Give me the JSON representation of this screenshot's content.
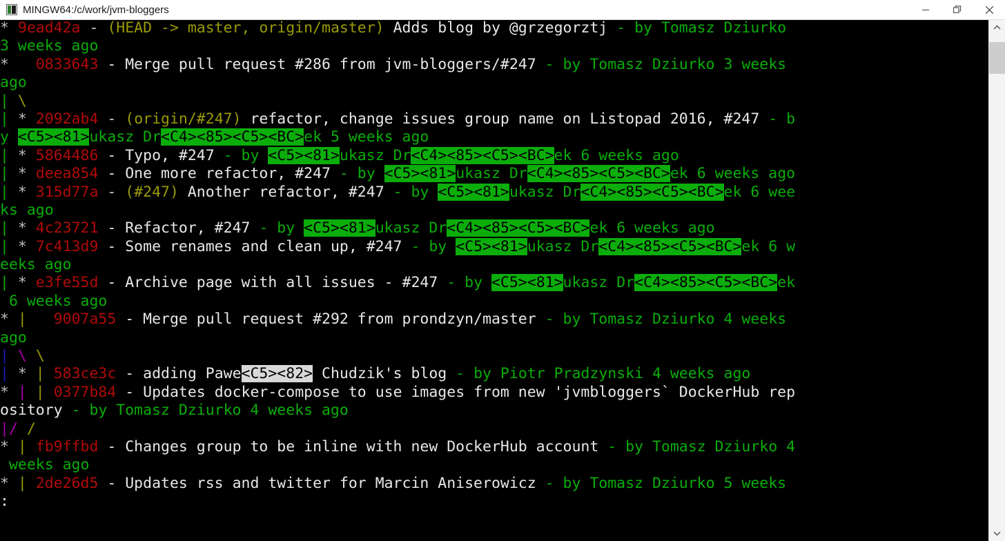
{
  "window": {
    "title": "MINGW64:/c/work/jvm-bloggers",
    "minimize_label": "Minimize",
    "maximize_label": "Restore",
    "close_label": "Close"
  },
  "scrollbar": {
    "up_label": "Scroll up",
    "down_label": "Scroll down"
  },
  "terminal": {
    "prompt": ":",
    "rows": [
      [
        {
          "t": "* ",
          "c": "c-gray"
        },
        {
          "t": "9ead42a",
          "c": "c-red"
        },
        {
          "t": " - ",
          "c": "c-default"
        },
        {
          "t": "(HEAD -> master, origin/master)",
          "c": "c-yellow"
        },
        {
          "t": " Adds blog by @grzegorztj",
          "c": "c-white"
        },
        {
          "t": " - by Tomasz Dziurko",
          "c": "c-green"
        }
      ],
      [
        {
          "t": "3 weeks ago",
          "c": "c-green"
        }
      ],
      [
        {
          "t": "*   ",
          "c": "c-gray"
        },
        {
          "t": "0833643",
          "c": "c-red"
        },
        {
          "t": " - Merge pull request #286 from jvm-bloggers/#247",
          "c": "c-white"
        },
        {
          "t": " - by Tomasz Dziurko 3 weeks",
          "c": "c-green"
        }
      ],
      [
        {
          "t": "ago",
          "c": "c-green"
        }
      ],
      [
        {
          "t": "|",
          "c": "c-green"
        },
        {
          "t": " ",
          "c": "c-default"
        },
        {
          "t": "\\",
          "c": "c-yellow"
        }
      ],
      [
        {
          "t": "|",
          "c": "c-green"
        },
        {
          "t": " * ",
          "c": "c-gray"
        },
        {
          "t": "2092ab4",
          "c": "c-red"
        },
        {
          "t": " - ",
          "c": "c-default"
        },
        {
          "t": "(origin/#247)",
          "c": "c-yellow"
        },
        {
          "t": " refactor, change issues group name on Listopad 2016, #247",
          "c": "c-white"
        },
        {
          "t": " - b",
          "c": "c-green"
        }
      ],
      [
        {
          "t": "y",
          "c": "c-green"
        },
        {
          "t": " ",
          "c": "c-green"
        },
        {
          "t": "<C5><81>",
          "c": "hl-green"
        },
        {
          "t": "ukasz Dr",
          "c": "c-green"
        },
        {
          "t": "<C4><85><C5><BC>",
          "c": "hl-green"
        },
        {
          "t": "ek 5 weeks ago",
          "c": "c-green"
        }
      ],
      [
        {
          "t": "|",
          "c": "c-green"
        },
        {
          "t": " * ",
          "c": "c-gray"
        },
        {
          "t": "5864486",
          "c": "c-red"
        },
        {
          "t": " - Typo, #247",
          "c": "c-white"
        },
        {
          "t": " - by ",
          "c": "c-green"
        },
        {
          "t": "<C5><81>",
          "c": "hl-green"
        },
        {
          "t": "ukasz Dr",
          "c": "c-green"
        },
        {
          "t": "<C4><85><C5><BC>",
          "c": "hl-green"
        },
        {
          "t": "ek 6 weeks ago",
          "c": "c-green"
        }
      ],
      [
        {
          "t": "|",
          "c": "c-green"
        },
        {
          "t": " * ",
          "c": "c-gray"
        },
        {
          "t": "deea854",
          "c": "c-red"
        },
        {
          "t": " - One more refactor, #247",
          "c": "c-white"
        },
        {
          "t": " - by ",
          "c": "c-green"
        },
        {
          "t": "<C5><81>",
          "c": "hl-green"
        },
        {
          "t": "ukasz Dr",
          "c": "c-green"
        },
        {
          "t": "<C4><85><C5><BC>",
          "c": "hl-green"
        },
        {
          "t": "ek 6 weeks ago",
          "c": "c-green"
        }
      ],
      [
        {
          "t": "|",
          "c": "c-green"
        },
        {
          "t": " * ",
          "c": "c-gray"
        },
        {
          "t": "315d77a",
          "c": "c-red"
        },
        {
          "t": " - ",
          "c": "c-default"
        },
        {
          "t": "(#247)",
          "c": "c-yellow"
        },
        {
          "t": " Another refactor, #247",
          "c": "c-white"
        },
        {
          "t": " - by ",
          "c": "c-green"
        },
        {
          "t": "<C5><81>",
          "c": "hl-green"
        },
        {
          "t": "ukasz Dr",
          "c": "c-green"
        },
        {
          "t": "<C4><85><C5><BC>",
          "c": "hl-green"
        },
        {
          "t": "ek 6 wee",
          "c": "c-green"
        }
      ],
      [
        {
          "t": "ks ago",
          "c": "c-green"
        }
      ],
      [
        {
          "t": "|",
          "c": "c-green"
        },
        {
          "t": " * ",
          "c": "c-gray"
        },
        {
          "t": "4c23721",
          "c": "c-red"
        },
        {
          "t": " - Refactor, #247",
          "c": "c-white"
        },
        {
          "t": " - by ",
          "c": "c-green"
        },
        {
          "t": "<C5><81>",
          "c": "hl-green"
        },
        {
          "t": "ukasz Dr",
          "c": "c-green"
        },
        {
          "t": "<C4><85><C5><BC>",
          "c": "hl-green"
        },
        {
          "t": "ek 6 weeks ago",
          "c": "c-green"
        }
      ],
      [
        {
          "t": "|",
          "c": "c-green"
        },
        {
          "t": " * ",
          "c": "c-gray"
        },
        {
          "t": "7c413d9",
          "c": "c-red"
        },
        {
          "t": " - Some renames and clean up, #247",
          "c": "c-white"
        },
        {
          "t": " - by ",
          "c": "c-green"
        },
        {
          "t": "<C5><81>",
          "c": "hl-green"
        },
        {
          "t": "ukasz Dr",
          "c": "c-green"
        },
        {
          "t": "<C4><85><C5><BC>",
          "c": "hl-green"
        },
        {
          "t": "ek 6 w",
          "c": "c-green"
        }
      ],
      [
        {
          "t": "eeks ago",
          "c": "c-green"
        }
      ],
      [
        {
          "t": "|",
          "c": "c-green"
        },
        {
          "t": " * ",
          "c": "c-gray"
        },
        {
          "t": "e3fe55d",
          "c": "c-red"
        },
        {
          "t": " - Archive page with all issues - #247",
          "c": "c-white"
        },
        {
          "t": " - by ",
          "c": "c-green"
        },
        {
          "t": "<C5><81>",
          "c": "hl-green"
        },
        {
          "t": "ukasz Dr",
          "c": "c-green"
        },
        {
          "t": "<C4><85><C5><BC>",
          "c": "hl-green"
        },
        {
          "t": "ek",
          "c": "c-green"
        }
      ],
      [
        {
          "t": " 6 weeks ago",
          "c": "c-green"
        }
      ],
      [
        {
          "t": "* ",
          "c": "c-gray"
        },
        {
          "t": "|",
          "c": "c-yellow"
        },
        {
          "t": "   ",
          "c": "c-default"
        },
        {
          "t": "9007a55",
          "c": "c-red"
        },
        {
          "t": " - Merge pull request #292 from prondzyn/master",
          "c": "c-white"
        },
        {
          "t": " - by Tomasz Dziurko 4 weeks",
          "c": "c-green"
        }
      ],
      [
        {
          "t": "ago",
          "c": "c-green"
        }
      ],
      [
        {
          "t": "|",
          "c": "c-blue"
        },
        {
          "t": " ",
          "c": "c-default"
        },
        {
          "t": "\\",
          "c": "c-magenta"
        },
        {
          "t": " ",
          "c": "c-default"
        },
        {
          "t": "\\",
          "c": "c-yellow"
        }
      ],
      [
        {
          "t": "|",
          "c": "c-blue"
        },
        {
          "t": " * ",
          "c": "c-gray"
        },
        {
          "t": "|",
          "c": "c-yellow"
        },
        {
          "t": " ",
          "c": "c-default"
        },
        {
          "t": "583ce3c",
          "c": "c-red"
        },
        {
          "t": " - adding Pawe",
          "c": "c-white"
        },
        {
          "t": "<C5><82>",
          "c": "hl-light"
        },
        {
          "t": " Chudzik's blog",
          "c": "c-white"
        },
        {
          "t": " - by Piotr Pradzynski 4 weeks ago",
          "c": "c-green"
        }
      ],
      [
        {
          "t": "* ",
          "c": "c-gray"
        },
        {
          "t": "|",
          "c": "c-magenta"
        },
        {
          "t": " ",
          "c": "c-default"
        },
        {
          "t": "|",
          "c": "c-yellow"
        },
        {
          "t": " ",
          "c": "c-default"
        },
        {
          "t": "0377b84",
          "c": "c-red"
        },
        {
          "t": " - Updates docker-compose to use images from new 'jvmbloggers` DockerHub rep",
          "c": "c-white"
        }
      ],
      [
        {
          "t": "ository",
          "c": "c-white"
        },
        {
          "t": " - by Tomasz Dziurko 4 weeks ago",
          "c": "c-green"
        }
      ],
      [
        {
          "t": "|",
          "c": "c-magenta"
        },
        {
          "t": "/ ",
          "c": "c-magenta"
        },
        {
          "t": "/",
          "c": "c-yellow"
        }
      ],
      [
        {
          "t": "* ",
          "c": "c-gray"
        },
        {
          "t": "|",
          "c": "c-yellow"
        },
        {
          "t": " ",
          "c": "c-default"
        },
        {
          "t": "fb9ffbd",
          "c": "c-red"
        },
        {
          "t": " - Changes group to be inline with new DockerHub account",
          "c": "c-white"
        },
        {
          "t": " - by Tomasz Dziurko 4",
          "c": "c-green"
        }
      ],
      [
        {
          "t": " weeks ago",
          "c": "c-green"
        }
      ],
      [
        {
          "t": "* ",
          "c": "c-gray"
        },
        {
          "t": "|",
          "c": "c-yellow"
        },
        {
          "t": " ",
          "c": "c-default"
        },
        {
          "t": "2de26d5",
          "c": "c-red"
        },
        {
          "t": " - Updates rss and twitter for Marcin Aniserowicz",
          "c": "c-white"
        },
        {
          "t": " - by Tomasz Dziurko 5 weeks",
          "c": "c-green"
        }
      ],
      [
        {
          "t": ":",
          "c": "c-white"
        }
      ]
    ]
  }
}
